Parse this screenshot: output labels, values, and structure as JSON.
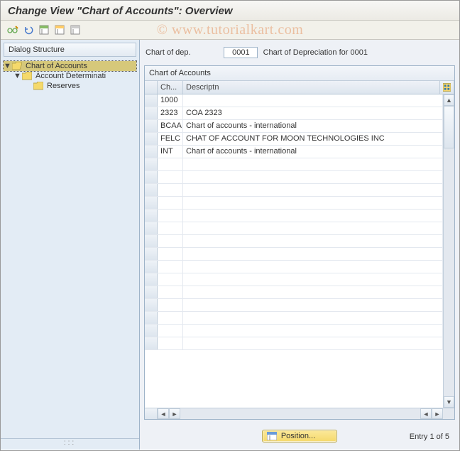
{
  "header": {
    "title": "Change View \"Chart of Accounts\": Overview"
  },
  "watermark": "© www.tutorialkart.com",
  "toolbar": {
    "icons": [
      "glasses-pencil-icon",
      "undo-icon",
      "sheet-select-icon",
      "sheet-all-icon",
      "sheet-clear-icon"
    ]
  },
  "sidebar": {
    "title": "Dialog Structure",
    "items": [
      {
        "label": "Chart of Accounts",
        "level": 0,
        "expanded": true,
        "selected": true,
        "hasChildren": true,
        "open": true
      },
      {
        "label": "Account Determinati",
        "level": 1,
        "expanded": true,
        "selected": false,
        "hasChildren": true,
        "open": false
      },
      {
        "label": "Reserves",
        "level": 2,
        "expanded": false,
        "selected": false,
        "hasChildren": false,
        "open": false
      }
    ]
  },
  "content": {
    "dep_label": "Chart of dep.",
    "dep_value": "0001",
    "dep_desc": "Chart of Depreciation for 0001",
    "grid_title": "Chart of Accounts",
    "columns": {
      "ch": "Ch...",
      "desc": "Descriptn"
    },
    "rows": [
      {
        "ch": "1000",
        "desc": ""
      },
      {
        "ch": "2323",
        "desc": "COA 2323"
      },
      {
        "ch": "BCAA",
        "desc": "Chart of accounts - international"
      },
      {
        "ch": "FELC",
        "desc": "CHAT OF ACCOUNT FOR MOON TECHNOLOGIES INC"
      },
      {
        "ch": "INT",
        "desc": "Chart of accounts - international"
      }
    ],
    "empty_rows": 15
  },
  "footer": {
    "position_label": "Position...",
    "entry_label": "Entry 1 of 5"
  }
}
